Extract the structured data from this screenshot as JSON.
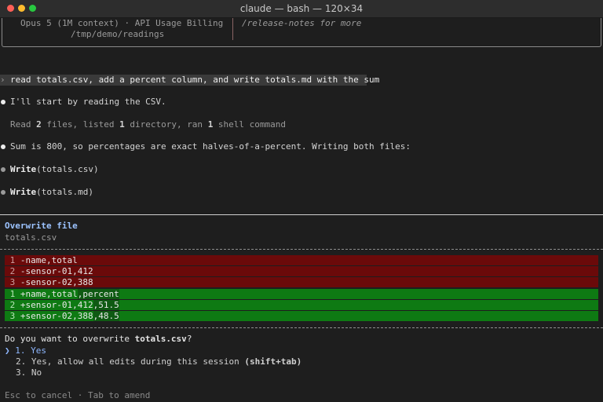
{
  "window": {
    "title": "claude — bash — 120×34"
  },
  "header": {
    "model_line": "Opus 5 (1M context) · API Usage Billing",
    "cwd": "/tmp/demo/readings",
    "release_hint": "/release-notes for more"
  },
  "prompt": {
    "glyph": "›",
    "text": "read totals.csv, add a percent column, and write totals.md with the sum"
  },
  "transcript": {
    "msg1": "I'll start by reading the CSV.",
    "summary": {
      "p1": "Read ",
      "n1": "2",
      "p2": " files, listed ",
      "n2": "1",
      "p3": " directory, ran ",
      "n3": "1",
      "p4": " shell command"
    },
    "msg2": "Sum is 800, so percentages are exact halves-of-a-percent. Writing both files:",
    "tool1": {
      "name": "Write",
      "arg": "(totals.csv)"
    },
    "tool2": {
      "name": "Write",
      "arg": "(totals.md)"
    }
  },
  "panel": {
    "heading": "Overwrite file",
    "filename": "totals.csv",
    "diff": {
      "removed": [
        {
          "num": "1",
          "sign": "-",
          "text": "name,total"
        },
        {
          "num": "2",
          "sign": "-",
          "text": "sensor-01,412"
        },
        {
          "num": "3",
          "sign": "-",
          "text": "sensor-02,388"
        }
      ],
      "added": [
        {
          "num": "1",
          "sign": "+",
          "base": "name,total",
          "extra": ",percent"
        },
        {
          "num": "2",
          "sign": "+",
          "base": "sensor-01,412",
          "extra": ",51.5"
        },
        {
          "num": "3",
          "sign": "+",
          "base": "sensor-02,388",
          "extra": ",48.5"
        }
      ]
    },
    "question": {
      "prefix": "Do you want to overwrite ",
      "file": "totals.csv",
      "suffix": "?"
    },
    "options": {
      "cursor": "❯",
      "o1": "1. Yes",
      "o2": "2. Yes, allow all edits during this session ",
      "o2_key": "(shift+tab)",
      "o3": "3. No"
    },
    "footer": "Esc to cancel · Tab to amend"
  },
  "colors": {
    "removed_bg": "#6b0a0a",
    "added_bg": "#0e7a13",
    "selected_option": "#8fb8ff",
    "heading": "#9cc3ff"
  }
}
